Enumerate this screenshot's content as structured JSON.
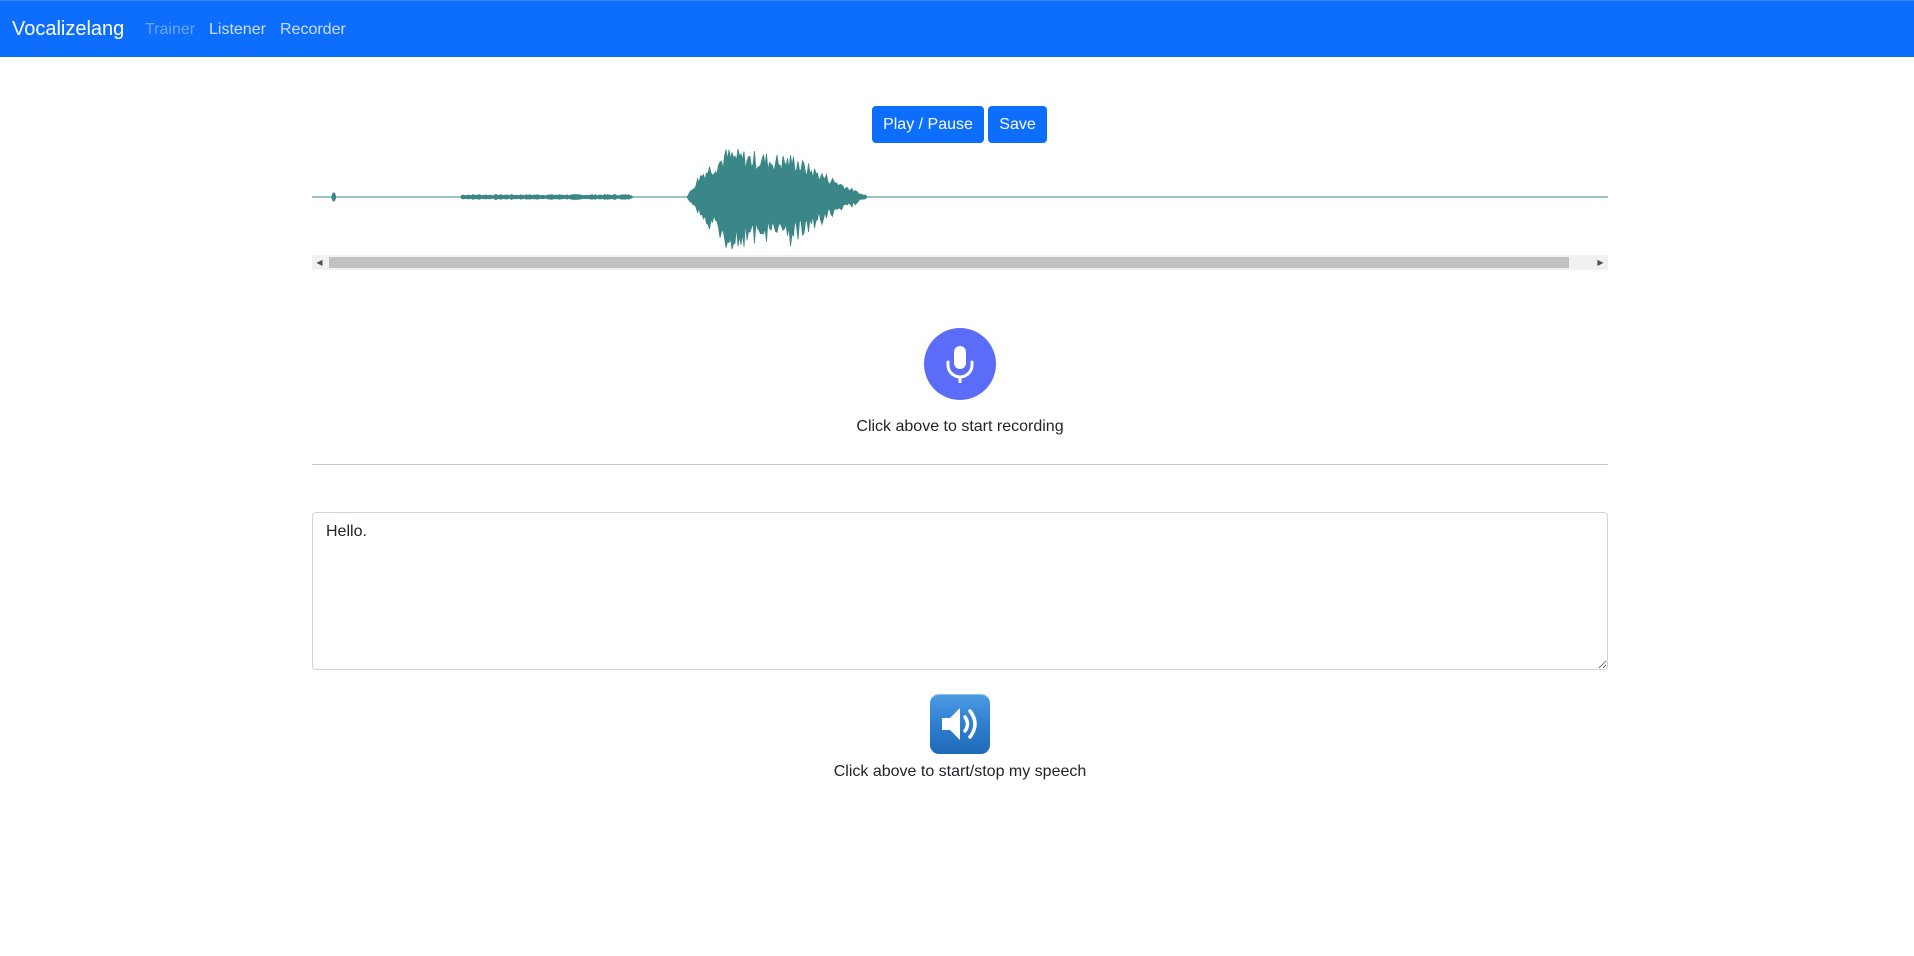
{
  "navbar": {
    "brand": "Vocalizelang",
    "links": [
      {
        "label": "Trainer",
        "disabled": true
      },
      {
        "label": "Listener",
        "disabled": false
      },
      {
        "label": "Recorder",
        "disabled": false
      }
    ],
    "color": "#0d6efd"
  },
  "player": {
    "play_pause_label": "Play / Pause",
    "save_label": "Save",
    "waveform_color": "#3b8686"
  },
  "recorder": {
    "icon": "microphone-icon",
    "caption": "Click above to start recording",
    "color": "#5b6cf9"
  },
  "speech": {
    "text_value": "Hello.",
    "icon": "speaker-icon",
    "caption": "Click above to start/stop my speech"
  }
}
